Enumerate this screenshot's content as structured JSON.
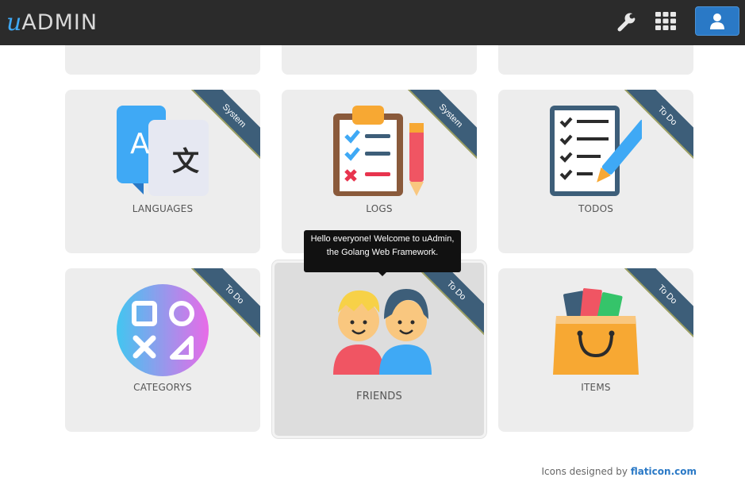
{
  "app": {
    "logo_u": "u",
    "logo_text": "ADMIN"
  },
  "nav": {
    "settings_icon": "wrench-icon",
    "apps_icon": "grid-icon",
    "user_icon": "user-icon"
  },
  "cards": [
    {
      "label": "LANGUAGES",
      "ribbon": "System",
      "icon": "translate-icon"
    },
    {
      "label": "LOGS",
      "ribbon": "System",
      "icon": "clipboard-log-icon"
    },
    {
      "label": "TODOS",
      "ribbon": "To Do",
      "icon": "checklist-icon"
    },
    {
      "label": "CATEGORYS",
      "ribbon": "To Do",
      "icon": "shapes-icon"
    },
    {
      "label": "FRIENDS",
      "ribbon": "To Do",
      "icon": "friends-icon"
    },
    {
      "label": "ITEMS",
      "ribbon": "To Do",
      "icon": "shopping-bag-icon"
    }
  ],
  "tooltip": {
    "text": "Hello everyone! Welcome to uAdmin, the Golang Web Framework."
  },
  "footer": {
    "prefix": "Icons designed by ",
    "link": "flaticon.com"
  },
  "colors": {
    "navbar": "#2b2b2b",
    "accent": "#2a79c6",
    "ribbon": "#3d5e79",
    "card": "#ededed"
  }
}
